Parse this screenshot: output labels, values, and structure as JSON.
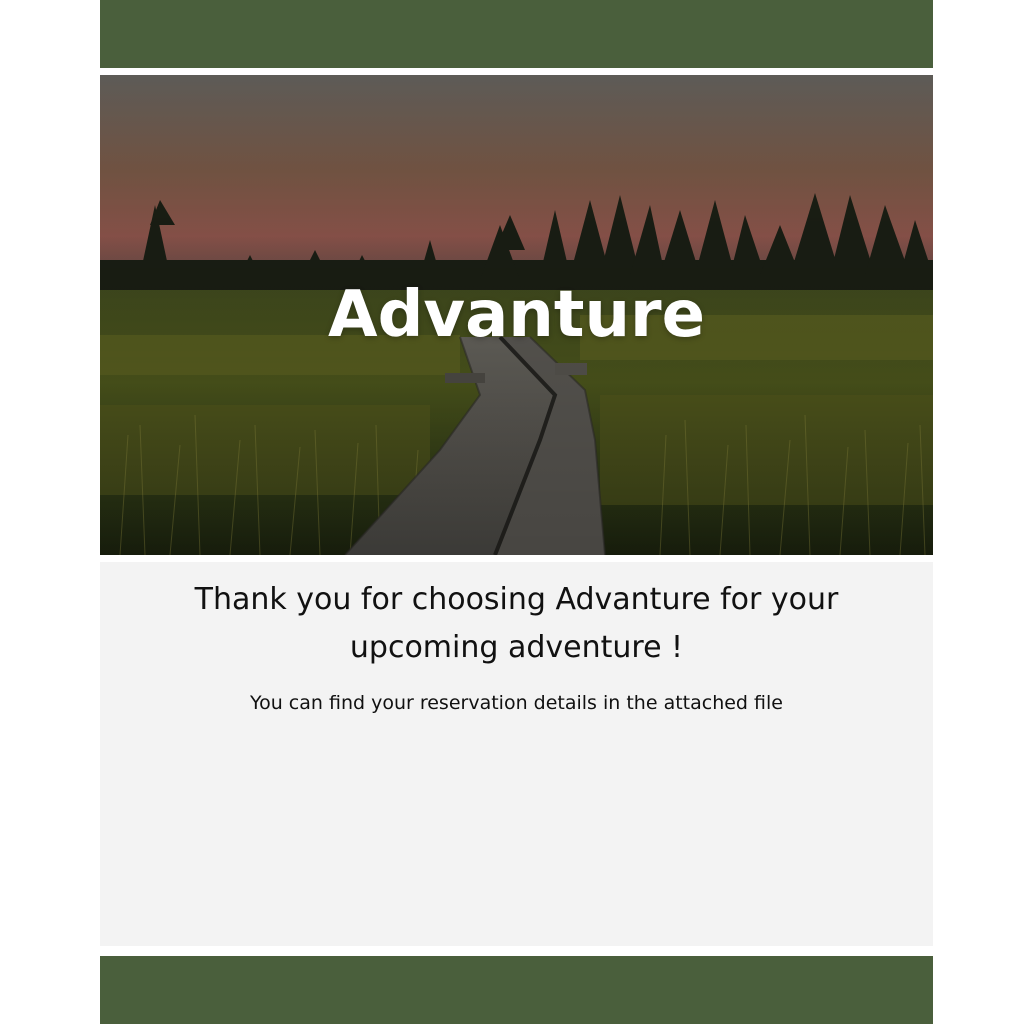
{
  "brand": {
    "bar_color": "#4a5f3c",
    "panel_color": "#f3f3f3"
  },
  "hero": {
    "title": "Advanture",
    "image_icon": "boardwalk-marsh-sunset-photo"
  },
  "message": {
    "headline": "Thank you for choosing Advanture for your upcoming adventure !",
    "details": "You can find your reservation details in the attached file"
  }
}
